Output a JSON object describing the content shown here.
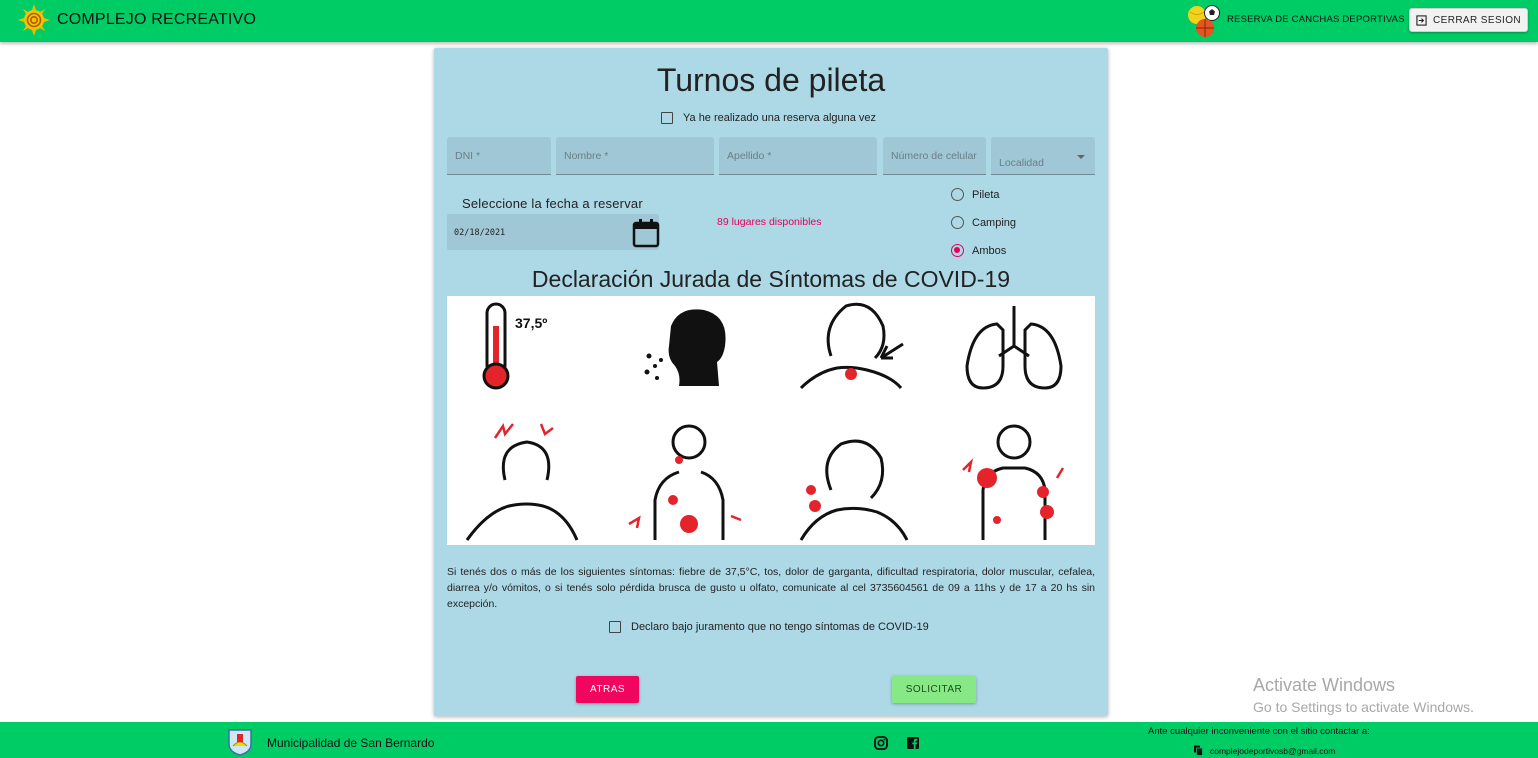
{
  "header": {
    "brand_title": "COMPLEJO RECREATIVO",
    "reserva_link": "RESERVA DE CANCHAS DEPORTIVAS",
    "logout_label": "CERRAR SESION"
  },
  "form": {
    "title": "Turnos de pileta",
    "already_reserved_label": "Ya he realizado una reserva alguna vez",
    "already_reserved_checked": false,
    "fields": {
      "dni": "DNI *",
      "nombre": "Nombre *",
      "apellido": "Apellido *",
      "celular": "Número de celular",
      "localidad": "Localidad"
    },
    "date_label": "Seleccione la fecha a reservar",
    "date_value": "02/18/2021",
    "availability": "89 lugares disponibles",
    "options": [
      "Pileta",
      "Camping",
      "Ambos"
    ],
    "selected_option": "Ambos"
  },
  "declaration": {
    "title": "Declaración Jurada de Síntomas de COVID-19",
    "temperature_label": "37,5º",
    "symptom_icons": [
      "fever-icon",
      "cough-icon",
      "sore-throat-icon",
      "lungs-icon",
      "headache-icon",
      "muscle-pain-icon",
      "taste-loss-icon",
      "body-ache-icon"
    ],
    "text": "Si tenés dos o más de los siguientes síntomas: fiebre de 37,5°C, tos, dolor de garganta, dificultad respiratoria, dolor muscular, cefalea, diarrea y/o vómitos, o si tenés solo pérdida brusca de gusto u olfato, comunicate al cel 3735604561 de 09 a 11hs y de 17 a 20 hs sin excepción.",
    "checkbox_label": "Declaro bajo juramento que no tengo síntomas de COVID-19",
    "checkbox_checked": false
  },
  "actions": {
    "back_label": "ATRAS",
    "submit_label": "SOLICITAR"
  },
  "watermark": {
    "title": "Activate Windows",
    "subtitle": "Go to Settings to activate Windows."
  },
  "footer": {
    "municipality": "Municipalidad de San Bernardo",
    "contact_label": "Ante cualquier inconveniente con el sitio contactar a:",
    "contact_email": "complejodeportivosb@gmail.com"
  },
  "colors": {
    "bar_green": "#00cc66",
    "card_blue": "#add8e6",
    "accent_pink": "#f0055f",
    "submit_green": "#86e986"
  }
}
